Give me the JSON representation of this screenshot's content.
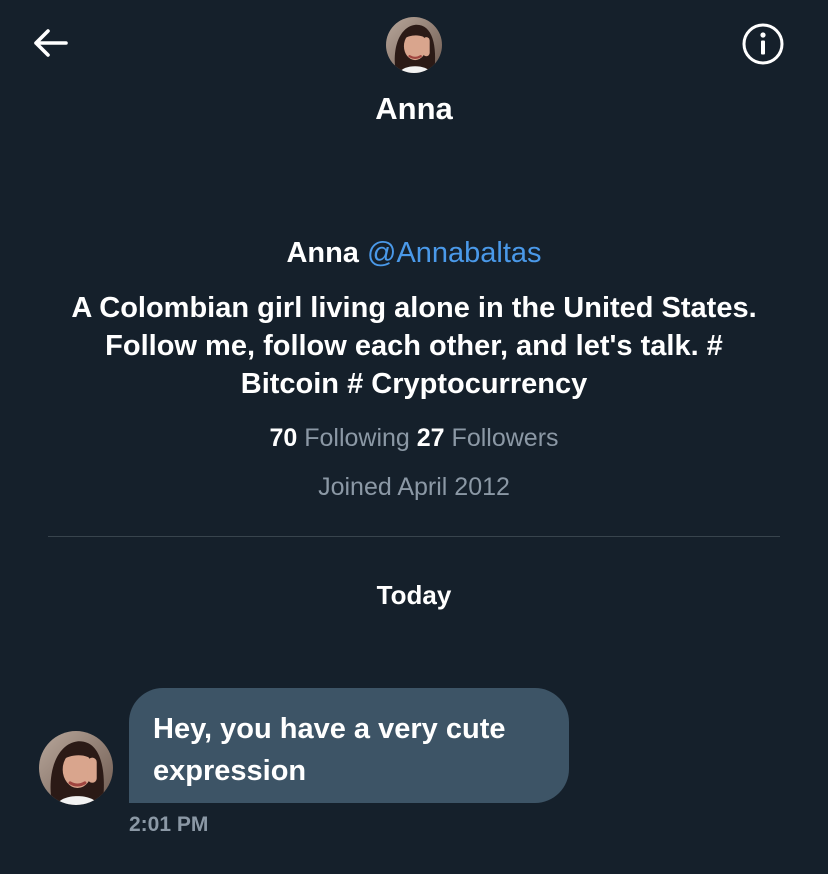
{
  "header": {
    "title": "Anna",
    "back_icon": "arrow-left-icon",
    "info_icon": "info-circle-icon"
  },
  "profile": {
    "name": "Anna",
    "handle": "@Annabaltas",
    "bio": "A Colombian girl living alone in the United States. Follow me, follow each other, and let's talk. # Bitcoin # Cryptocurrency",
    "following_count": "70",
    "following_label": "Following",
    "followers_count": "27",
    "followers_label": "Followers",
    "joined": "Joined April 2012"
  },
  "conversation": {
    "date_separator": "Today",
    "messages": [
      {
        "text": "Hey, you have a very cute expression",
        "time": "2:01 PM"
      }
    ]
  },
  "colors": {
    "background": "#15202b",
    "accent": "#4a99e9",
    "secondary_text": "#8b98a5",
    "bubble": "#3d5466",
    "divider": "#38444d"
  }
}
